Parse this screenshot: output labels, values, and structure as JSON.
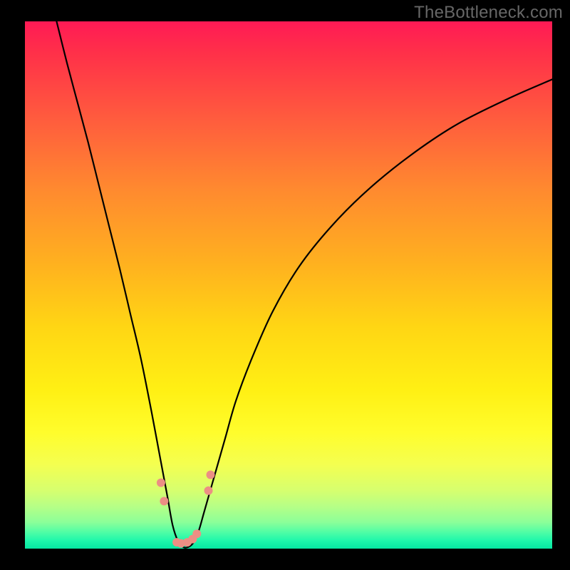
{
  "watermark": "TheBottleneck.com",
  "chart_data": {
    "type": "line",
    "title": "",
    "xlabel": "",
    "ylabel": "",
    "xlim": [
      0,
      100
    ],
    "ylim": [
      0,
      100
    ],
    "grid": false,
    "legend": false,
    "background_gradient": {
      "direction": "vertical",
      "stops": [
        {
          "pos": 0,
          "color": "#ff1a55"
        },
        {
          "pos": 0.3,
          "color": "#ff8030"
        },
        {
          "pos": 0.6,
          "color": "#ffe015"
        },
        {
          "pos": 0.85,
          "color": "#e8ff55"
        },
        {
          "pos": 1.0,
          "color": "#05e7a2"
        }
      ]
    },
    "series": [
      {
        "name": "bottleneck-curve",
        "color": "#000000",
        "stroke_width": 2,
        "x": [
          6,
          8,
          10,
          12,
          14,
          16,
          18,
          20,
          22,
          24,
          25.5,
          27,
          28,
          29,
          30,
          31,
          32,
          33,
          34,
          36,
          38,
          40,
          43,
          47,
          52,
          58,
          65,
          73,
          82,
          92,
          100
        ],
        "y": [
          100,
          92,
          84.5,
          77,
          69,
          61,
          53,
          44.5,
          36,
          26,
          18,
          10,
          4.5,
          1.5,
          0.3,
          0.3,
          1.2,
          3.5,
          7,
          14,
          21,
          28,
          36,
          45,
          53.5,
          61,
          68,
          74.5,
          80.5,
          85.5,
          89
        ]
      },
      {
        "name": "marker-dots",
        "type": "scatter",
        "color": "#ec8f84",
        "marker_size": 12,
        "points": [
          {
            "x": 25.8,
            "y": 12.5
          },
          {
            "x": 26.4,
            "y": 9.0
          },
          {
            "x": 28.8,
            "y": 1.2
          },
          {
            "x": 29.6,
            "y": 1.0
          },
          {
            "x": 30.8,
            "y": 1.2
          },
          {
            "x": 31.8,
            "y": 1.8
          },
          {
            "x": 32.6,
            "y": 2.8
          },
          {
            "x": 34.8,
            "y": 11.0
          },
          {
            "x": 35.2,
            "y": 14.0
          }
        ]
      }
    ]
  }
}
